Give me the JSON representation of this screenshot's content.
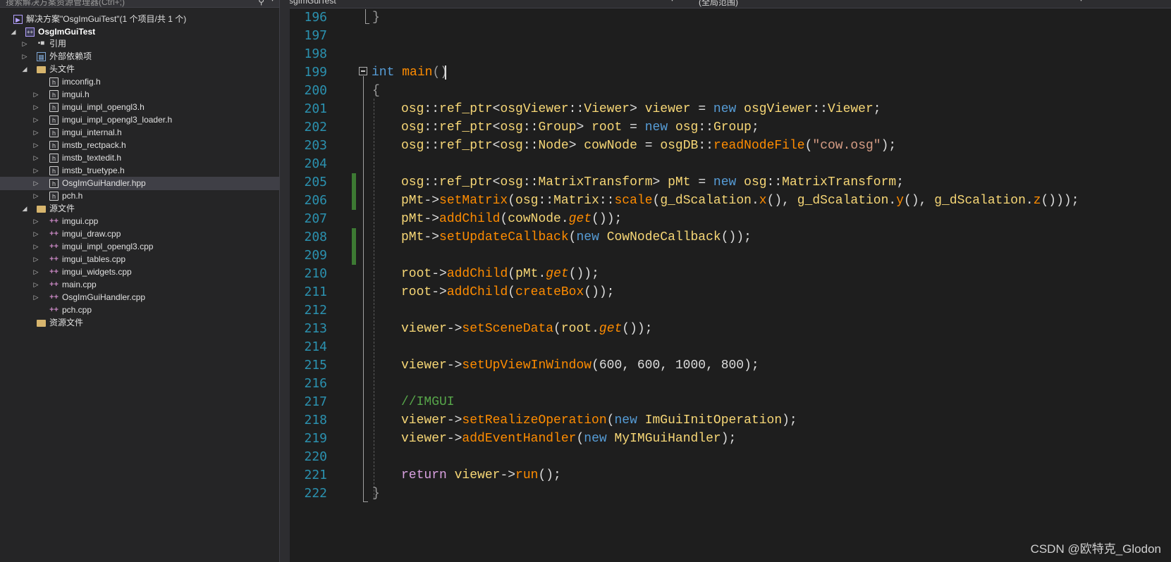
{
  "solution_explorer": {
    "search_placeholder": "搜索解决方案资源管理器(Ctrl+;)",
    "solution_label": "解决方案\"OsgImGuiTest\"(1 个项目/共 1 个)",
    "project_label": "OsgImGuiTest",
    "references_label": "引用",
    "external_deps_label": "外部依赖项",
    "headers_folder_label": "头文件",
    "header_files": [
      "imconfig.h",
      "imgui.h",
      "imgui_impl_opengl3.h",
      "imgui_impl_opengl3_loader.h",
      "imgui_internal.h",
      "imstb_rectpack.h",
      "imstb_textedit.h",
      "imstb_truetype.h",
      "OsgImGuiHandler.hpp",
      "pch.h"
    ],
    "sources_folder_label": "源文件",
    "source_files": [
      "imgui.cpp",
      "imgui_draw.cpp",
      "imgui_impl_opengl3.cpp",
      "imgui_tables.cpp",
      "imgui_widgets.cpp",
      "main.cpp",
      "OsgImGuiHandler.cpp",
      "pch.cpp"
    ],
    "resources_folder_label": "资源文件",
    "selected_item": "OsgImGuiHandler.hpp"
  },
  "editor": {
    "nav_project": "OsgImGuiTest",
    "nav_scope": "(全局范围)",
    "line_numbers": [
      "196",
      "197",
      "198",
      "199",
      "200",
      "201",
      "202",
      "203",
      "204",
      "205",
      "206",
      "207",
      "208",
      "209",
      "210",
      "211",
      "212",
      "213",
      "214",
      "215",
      "216",
      "217",
      "218",
      "219",
      "220",
      "221",
      "222"
    ],
    "lines": {
      "l196": "}",
      "l199_kw": "int",
      "l199_fn": "main",
      "l199_rest": "()",
      "l200": "{",
      "l201": [
        "osg",
        "::",
        "ref_ptr",
        "<",
        "osgViewer",
        "::",
        "Viewer",
        "> ",
        "viewer",
        " = ",
        "new",
        " ",
        "osgViewer",
        "::",
        "Viewer",
        ";"
      ],
      "l202": [
        "osg",
        "::",
        "ref_ptr",
        "<",
        "osg",
        "::",
        "Group",
        "> ",
        "root",
        " = ",
        "new",
        " ",
        "osg",
        "::",
        "Group",
        ";"
      ],
      "l203": [
        "osg",
        "::",
        "ref_ptr",
        "<",
        "osg",
        "::",
        "Node",
        "> ",
        "cowNode",
        " = ",
        "osgDB",
        "::",
        "readNodeFile",
        "(",
        "\"cow.osg\"",
        ");"
      ],
      "l205": [
        "osg",
        "::",
        "ref_ptr",
        "<",
        "osg",
        "::",
        "MatrixTransform",
        "> ",
        "pMt",
        " = ",
        "new",
        " ",
        "osg",
        "::",
        "MatrixTransform",
        ";"
      ],
      "l206": [
        "pMt",
        "->",
        "setMatrix",
        "(",
        "osg",
        "::",
        "Matrix",
        "::",
        "scale",
        "(",
        "g_dScalation",
        ".",
        "x",
        "(), ",
        "g_dScalation",
        ".",
        "y",
        "(), ",
        "g_dScalation",
        ".",
        "z",
        "()));"
      ],
      "l207": [
        "pMt",
        "->",
        "addChild",
        "(",
        "cowNode",
        ".",
        "get",
        "());"
      ],
      "l208": [
        "pMt",
        "->",
        "setUpdateCallback",
        "(",
        "new",
        " ",
        "CowNodeCallback",
        "());"
      ],
      "l210": [
        "root",
        "->",
        "addChild",
        "(",
        "pMt",
        ".",
        "get",
        "());"
      ],
      "l211": [
        "root",
        "->",
        "addChild",
        "(",
        "createBox",
        "());"
      ],
      "l213": [
        "viewer",
        "->",
        "setSceneData",
        "(",
        "root",
        ".",
        "get",
        "());"
      ],
      "l215": [
        "viewer",
        "->",
        "setUpViewInWindow",
        "(600, 600, 1000, 800);"
      ],
      "l217": "//IMGUI",
      "l218": [
        "viewer",
        "->",
        "setRealizeOperation",
        "(",
        "new",
        " ",
        "ImGuiInitOperation",
        ");"
      ],
      "l219": [
        "viewer",
        "->",
        "addEventHandler",
        "(",
        "new",
        " ",
        "MyIMGuiHandler",
        ");"
      ],
      "l221": [
        "return",
        " ",
        "viewer",
        "->",
        "run",
        "();"
      ],
      "l222": "}"
    }
  },
  "watermark": "CSDN @欧特克_Glodon",
  "colors": {
    "keyword": "#569cd6",
    "function": "#ff8c00",
    "class": "#f7d776",
    "comment": "#57a64a",
    "string": "#d69d85",
    "line_number": "#2b91af",
    "change_bar": "#3d7a33"
  }
}
